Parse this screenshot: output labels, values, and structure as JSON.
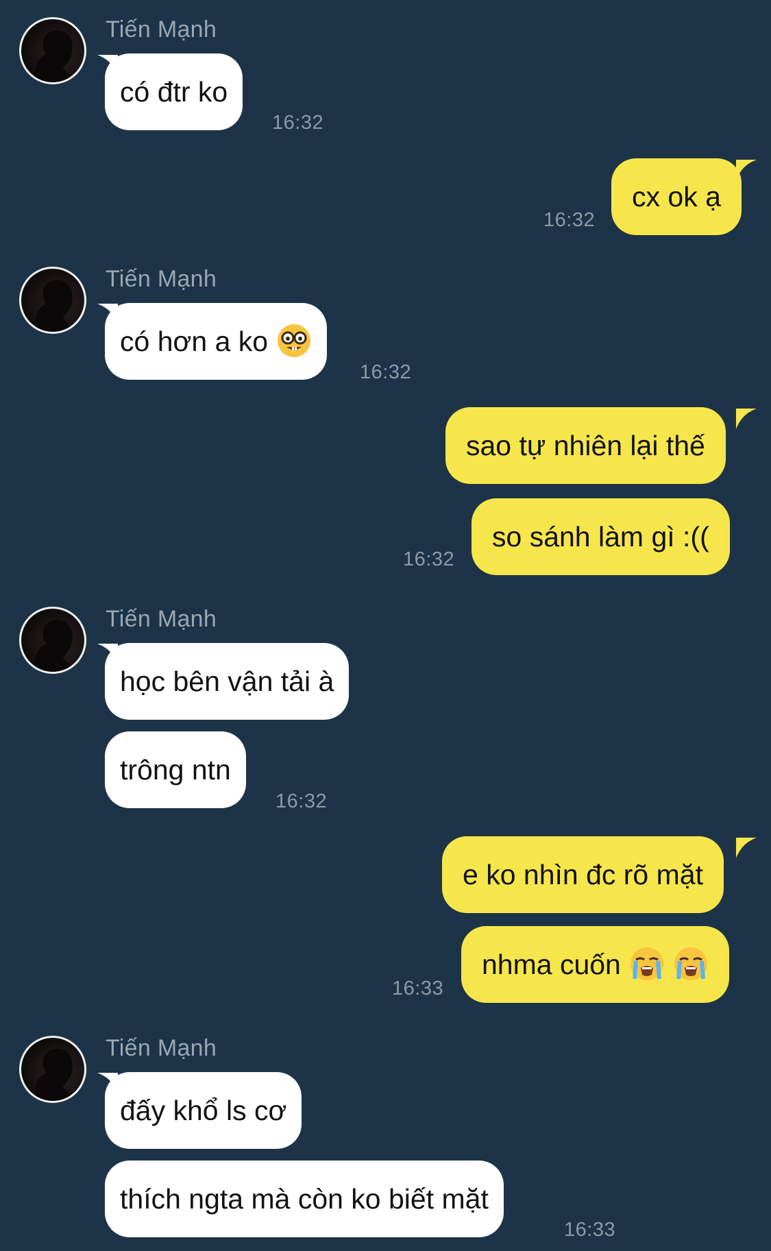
{
  "sender_name": "Tiến Mạnh",
  "colors": {
    "background": "#1d3448",
    "incoming_bubble": "#ffffff",
    "outgoing_bubble": "#f7e64b",
    "timestamp": "#8c9aa7",
    "sender_name": "#9aa7b3"
  },
  "messages": {
    "m1": {
      "text": "có đtr ko",
      "time": "16:32"
    },
    "m2": {
      "text": "cx ok ạ",
      "time": "16:32"
    },
    "m3": {
      "text": "có hơn a ko",
      "emoji": "nerd-face-emoji",
      "time": "16:32"
    },
    "m4": {
      "text": "sao tự nhiên lại thế"
    },
    "m5": {
      "text": "so sánh làm gì :((",
      "time": "16:32"
    },
    "m6": {
      "text": "học bên vận tải à"
    },
    "m7": {
      "text": "trông ntn",
      "time": "16:32"
    },
    "m8": {
      "text": "e ko nhìn đc rõ mặt"
    },
    "m9": {
      "text": "nhma cuốn",
      "emoji": "loudly-crying-face-emoji",
      "time": "16:33"
    },
    "m10": {
      "text": "đấy khổ ls cơ"
    },
    "m11": {
      "text": "thích ngta mà còn ko biết mặt",
      "time": "16:33"
    }
  }
}
